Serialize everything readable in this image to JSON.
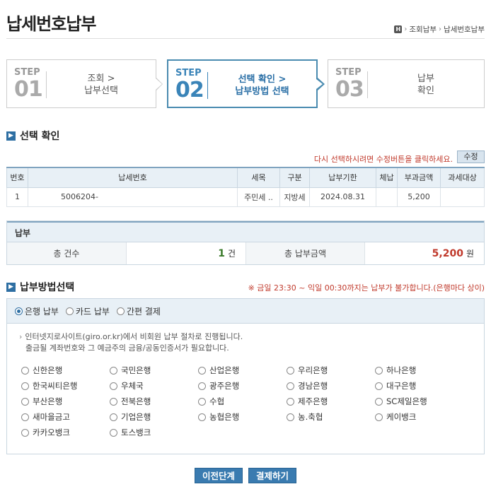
{
  "page": {
    "title": "납세번호납부",
    "breadcrumb": [
      "H",
      "조회납부",
      "납세번호납부"
    ]
  },
  "steps": [
    {
      "word": "STEP",
      "num": "01",
      "line1": "조회 >",
      "line2": "납부선택",
      "active": false
    },
    {
      "word": "STEP",
      "num": "02",
      "line1": "선택 확인 >",
      "line2": "납부방법 선택",
      "active": true
    },
    {
      "word": "STEP",
      "num": "03",
      "line1": "납부",
      "line2": "확인",
      "active": false
    }
  ],
  "selection": {
    "section_title": "선택 확인",
    "notice": "다시 선택하시려면 수정버튼을 클릭하세요.",
    "edit_label": "수정",
    "headers": [
      "번호",
      "납세번호",
      "세목",
      "구분",
      "납부기한",
      "체납",
      "부과금액",
      "과세대상"
    ],
    "rows": [
      [
        "1",
        "5006204-",
        "주민세 ..",
        "지방세",
        "2024.08.31",
        "",
        "5,200",
        ""
      ]
    ]
  },
  "payment": {
    "head": "납부",
    "count_label": "총 건수",
    "count_value": "1",
    "count_unit": "건",
    "amount_label": "총 납부금액",
    "amount_value": "5,200",
    "amount_unit": "원"
  },
  "method": {
    "section_title": "납부방법선택",
    "notice": "※ 금일 23:30 ~ 익일 00:30까지는 납부가 불가합니다.(은행마다 상이)",
    "tabs": [
      "은행 납부",
      "카드 납부",
      "간편 결제"
    ],
    "selected_tab": "은행 납부",
    "info_line1": "인터넷지로사이트(giro.or.kr)에서 비회원 납부 절차로 진행됩니다.",
    "info_line2": "출금될 계좌번호와 그 예금주의 금융/공동인증서가 필요합니다.",
    "banks": [
      "신한은행",
      "국민은행",
      "산업은행",
      "우리은행",
      "하나은행",
      "한국씨티은행",
      "우체국",
      "광주은행",
      "경남은행",
      "대구은행",
      "부산은행",
      "전북은행",
      "수협",
      "제주은행",
      "SC제일은행",
      "새마을금고",
      "기업은행",
      "농협은행",
      "농.축협",
      "케이뱅크",
      "카카오뱅크",
      "토스뱅크"
    ]
  },
  "buttons": {
    "prev": "이전단계",
    "pay": "결제하기"
  },
  "colors": {
    "accent": "#3a84b8",
    "notice_red": "#c0392b",
    "header_bg": "#e8f0f6"
  }
}
